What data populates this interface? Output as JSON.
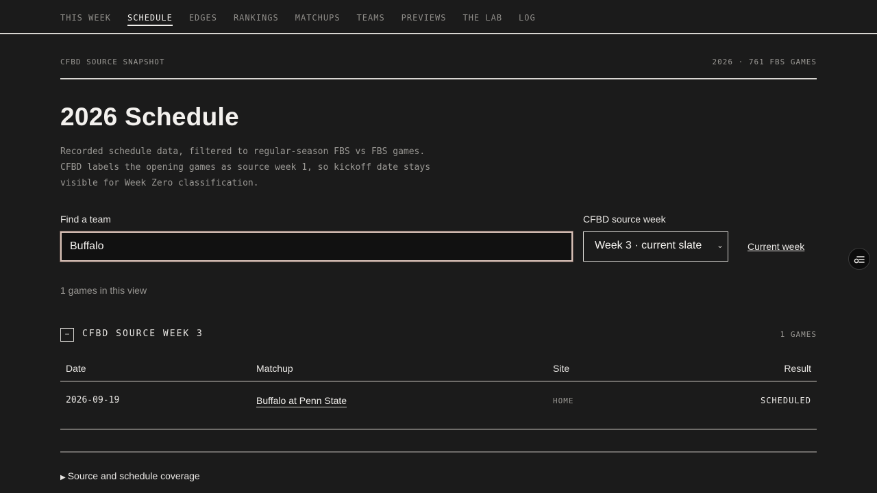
{
  "nav": {
    "items": [
      "THIS WEEK",
      "SCHEDULE",
      "EDGES",
      "RANKINGS",
      "MATCHUPS",
      "TEAMS",
      "PREVIEWS",
      "THE LAB",
      "LOG"
    ],
    "active": "SCHEDULE"
  },
  "snapshot": {
    "label": "CFBD SOURCE SNAPSHOT",
    "meta": "2026 · 761 FBS GAMES"
  },
  "page": {
    "title": "2026 Schedule",
    "description": "Recorded schedule data, filtered to regular-season FBS vs FBS games. CFBD labels the opening games as source week 1, so kickoff date stays visible for Week Zero classification."
  },
  "filters": {
    "team_label": "Find a team",
    "team_value": "Buffalo",
    "week_label": "CFBD source week",
    "week_value": "Week 3 · current slate",
    "current_week_link": "Current week"
  },
  "results": {
    "count_text": "1 games in this view"
  },
  "group": {
    "collapse_symbol": "−",
    "title": "CFBD SOURCE WEEK 3",
    "count": "1 GAMES"
  },
  "table": {
    "headers": {
      "date": "Date",
      "matchup": "Matchup",
      "site": "Site",
      "result": "Result"
    },
    "rows": [
      {
        "date": "2026-09-19",
        "matchup": "Buffalo at Penn State",
        "site": "HOME",
        "result": "SCHEDULED"
      }
    ]
  },
  "coverage": {
    "label": "Source and schedule coverage"
  },
  "fab": {
    "icon": "settings-filter-icon"
  }
}
